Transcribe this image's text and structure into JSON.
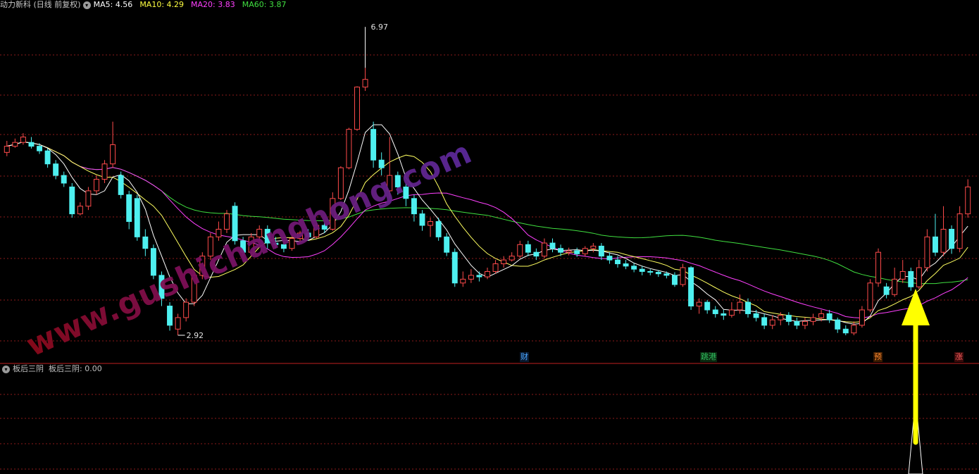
{
  "header": {
    "title": "动力新科 (日线 前复权)",
    "ma5_label": "MA5:",
    "ma5_value": "4.56",
    "ma10_label": "MA10:",
    "ma10_value": "4.29",
    "ma20_label": "MA20:",
    "ma20_value": "3.83",
    "ma60_label": "MA60:",
    "ma60_value": "3.87",
    "icon": "chevron-down-icon"
  },
  "indicator": {
    "title": "板后三阴",
    "label": "板后三阴:",
    "value": "0.00"
  },
  "annotations": {
    "high_label": "6.97",
    "low_label": "2.92"
  },
  "events": [
    {
      "label": "财",
      "color": "#4aa6ff"
    },
    {
      "label": "跳港",
      "color": "#30c060"
    },
    {
      "label": "预",
      "color": "#ff8a30"
    },
    {
      "label": "涨",
      "color": "#ff6060"
    }
  ],
  "watermark": "www.gushichanghong.com",
  "colors": {
    "up": "#ff4b4b",
    "down": "#4ef0f0",
    "ma5": "#ffffff",
    "ma10": "#ffff60",
    "ma20": "#ff40ff",
    "ma60": "#40e040",
    "grid": "#8b1a1a",
    "arrow": "#ffff00"
  },
  "chart_data": {
    "type": "candlestick",
    "title": "动力新科 (日线 前复权)",
    "ylim": [
      2.7,
      7.1
    ],
    "annotated_high": 6.97,
    "annotated_low": 2.92,
    "candles": [
      [
        5.3,
        5.38,
        5.45,
        5.25
      ],
      [
        5.38,
        5.43,
        5.48,
        5.36
      ],
      [
        5.43,
        5.5,
        5.55,
        5.4
      ],
      [
        5.43,
        5.38,
        5.5,
        5.35
      ],
      [
        5.38,
        5.32,
        5.42,
        5.28
      ],
      [
        5.32,
        5.15,
        5.35,
        5.1
      ],
      [
        5.15,
        5.0,
        5.2,
        4.95
      ],
      [
        5.0,
        4.9,
        5.05,
        4.85
      ],
      [
        4.85,
        4.5,
        4.9,
        4.45
      ],
      [
        4.5,
        4.6,
        4.65,
        4.48
      ],
      [
        4.6,
        4.8,
        4.85,
        4.55
      ],
      [
        4.8,
        4.95,
        5.0,
        4.75
      ],
      [
        4.95,
        5.15,
        5.2,
        4.9
      ],
      [
        5.15,
        5.4,
        5.7,
        5.1
      ],
      [
        5.0,
        4.75,
        5.05,
        4.7
      ],
      [
        4.75,
        4.4,
        4.8,
        4.3
      ],
      [
        4.7,
        4.2,
        4.75,
        4.15
      ],
      [
        4.2,
        4.05,
        4.3,
        3.95
      ],
      [
        4.05,
        3.7,
        4.1,
        3.65
      ],
      [
        3.7,
        3.4,
        3.75,
        3.3
      ],
      [
        3.3,
        3.05,
        3.35,
        2.98
      ],
      [
        3.0,
        3.15,
        3.2,
        2.92
      ],
      [
        3.15,
        3.35,
        3.4,
        3.1
      ],
      [
        3.35,
        3.7,
        3.75,
        3.3
      ],
      [
        3.7,
        3.95,
        4.0,
        3.65
      ],
      [
        3.95,
        4.2,
        4.25,
        3.9
      ],
      [
        4.2,
        4.3,
        4.4,
        4.15
      ],
      [
        4.3,
        4.5,
        4.55,
        4.25
      ],
      [
        4.6,
        4.15,
        4.65,
        4.1
      ],
      [
        4.15,
        4.0,
        4.2,
        3.95
      ],
      [
        4.0,
        4.2,
        4.25,
        3.95
      ],
      [
        4.2,
        4.3,
        4.35,
        4.15
      ],
      [
        4.3,
        4.12,
        4.35,
        4.05
      ],
      [
        4.12,
        4.1,
        4.2,
        4.05
      ],
      [
        4.1,
        4.05,
        4.15,
        4.0
      ],
      [
        4.05,
        4.18,
        4.22,
        4.02
      ],
      [
        4.18,
        4.25,
        4.28,
        4.12
      ],
      [
        4.25,
        4.2,
        4.3,
        4.15
      ],
      [
        4.2,
        4.35,
        4.38,
        4.18
      ],
      [
        4.35,
        4.3,
        4.4,
        4.25
      ],
      [
        4.3,
        4.7,
        4.78,
        4.28
      ],
      [
        4.7,
        5.1,
        5.12,
        4.68
      ],
      [
        5.1,
        5.6,
        5.62,
        5.08
      ],
      [
        5.6,
        6.15,
        6.16,
        5.58
      ],
      [
        6.15,
        6.25,
        6.4,
        6.1
      ],
      [
        5.6,
        5.2,
        5.7,
        5.1
      ],
      [
        5.2,
        5.1,
        5.3,
        5.0
      ],
      [
        4.8,
        5.0,
        5.5,
        4.7
      ],
      [
        5.0,
        4.85,
        5.05,
        4.75
      ],
      [
        4.85,
        4.7,
        4.9,
        4.6
      ],
      [
        4.7,
        4.5,
        4.75,
        4.4
      ],
      [
        4.5,
        4.35,
        4.55,
        4.28
      ],
      [
        4.35,
        4.4,
        4.45,
        4.2
      ],
      [
        4.4,
        4.2,
        4.45,
        4.15
      ],
      [
        4.2,
        4.0,
        4.25,
        3.95
      ],
      [
        4.0,
        3.6,
        4.05,
        3.55
      ],
      [
        3.6,
        3.65,
        3.75,
        3.55
      ],
      [
        3.65,
        3.7,
        3.78,
        3.6
      ],
      [
        3.7,
        3.68,
        3.75,
        3.62
      ],
      [
        3.68,
        3.75,
        3.8,
        3.65
      ],
      [
        3.75,
        3.85,
        3.9,
        3.72
      ],
      [
        3.85,
        3.9,
        3.95,
        3.8
      ],
      [
        3.9,
        3.95,
        4.0,
        3.88
      ],
      [
        3.95,
        4.1,
        4.15,
        3.92
      ],
      [
        4.1,
        4.0,
        4.15,
        3.95
      ],
      [
        4.0,
        3.95,
        4.05,
        3.9
      ],
      [
        3.95,
        4.12,
        4.18,
        3.92
      ],
      [
        4.12,
        4.05,
        4.18,
        4.0
      ],
      [
        4.05,
        4.0,
        4.1,
        3.95
      ],
      [
        4.0,
        4.02,
        4.06,
        3.96
      ],
      [
        4.02,
        3.98,
        4.06,
        3.94
      ],
      [
        3.98,
        4.05,
        4.08,
        3.95
      ],
      [
        4.05,
        4.08,
        4.12,
        4.0
      ],
      [
        4.08,
        3.95,
        4.12,
        3.9
      ],
      [
        3.95,
        3.9,
        4.0,
        3.85
      ],
      [
        3.9,
        3.85,
        3.95,
        3.8
      ],
      [
        3.85,
        3.82,
        3.9,
        3.78
      ],
      [
        3.82,
        3.78,
        3.86,
        3.74
      ],
      [
        3.78,
        3.75,
        3.82,
        3.7
      ],
      [
        3.75,
        3.74,
        3.78,
        3.7
      ],
      [
        3.74,
        3.72,
        3.77,
        3.68
      ],
      [
        3.72,
        3.7,
        3.75,
        3.66
      ],
      [
        3.7,
        3.58,
        3.74,
        3.55
      ],
      [
        3.58,
        3.8,
        3.85,
        3.55
      ],
      [
        3.8,
        3.3,
        3.82,
        3.25
      ],
      [
        3.3,
        3.35,
        3.4,
        3.2
      ],
      [
        3.35,
        3.25,
        3.38,
        3.2
      ],
      [
        3.25,
        3.2,
        3.3,
        3.15
      ],
      [
        3.2,
        3.18,
        3.25,
        3.12
      ],
      [
        3.18,
        3.25,
        3.35,
        3.15
      ],
      [
        3.25,
        3.35,
        3.45,
        3.2
      ],
      [
        3.35,
        3.2,
        3.4,
        3.15
      ],
      [
        3.2,
        3.15,
        3.25,
        3.1
      ],
      [
        3.15,
        3.05,
        3.2,
        3.0
      ],
      [
        3.05,
        3.12,
        3.18,
        3.0
      ],
      [
        3.12,
        3.18,
        3.22,
        3.05
      ],
      [
        3.18,
        3.1,
        3.22,
        3.05
      ],
      [
        3.1,
        3.05,
        3.15,
        3.0
      ],
      [
        3.05,
        3.1,
        3.15,
        3.0
      ],
      [
        3.1,
        3.15,
        3.2,
        3.05
      ],
      [
        3.15,
        3.2,
        3.25,
        3.1
      ],
      [
        3.2,
        3.12,
        3.25,
        3.08
      ],
      [
        3.12,
        3.0,
        3.15,
        2.95
      ],
      [
        3.0,
        2.95,
        3.05,
        2.92
      ],
      [
        2.95,
        3.05,
        3.1,
        2.92
      ],
      [
        3.05,
        3.25,
        3.3,
        3.02
      ],
      [
        3.25,
        3.6,
        3.65,
        3.22
      ],
      [
        3.6,
        4.0,
        4.05,
        3.55
      ],
      [
        3.55,
        3.45,
        3.6,
        3.4
      ],
      [
        3.45,
        3.65,
        3.8,
        3.42
      ],
      [
        3.65,
        3.75,
        3.9,
        3.6
      ],
      [
        3.75,
        3.55,
        3.8,
        3.5
      ],
      [
        3.55,
        3.8,
        3.9,
        3.52
      ],
      [
        3.8,
        4.2,
        4.3,
        3.75
      ],
      [
        4.2,
        4.0,
        4.5,
        3.95
      ],
      [
        4.0,
        4.3,
        4.6,
        3.95
      ],
      [
        4.3,
        4.05,
        4.35,
        3.98
      ],
      [
        4.05,
        4.5,
        4.6,
        4.0
      ],
      [
        4.5,
        4.85,
        4.95,
        4.45
      ]
    ],
    "ma5": "computed from closes",
    "ma10": "computed from closes",
    "ma20": "computed from closes",
    "ma60": "computed from closes"
  }
}
